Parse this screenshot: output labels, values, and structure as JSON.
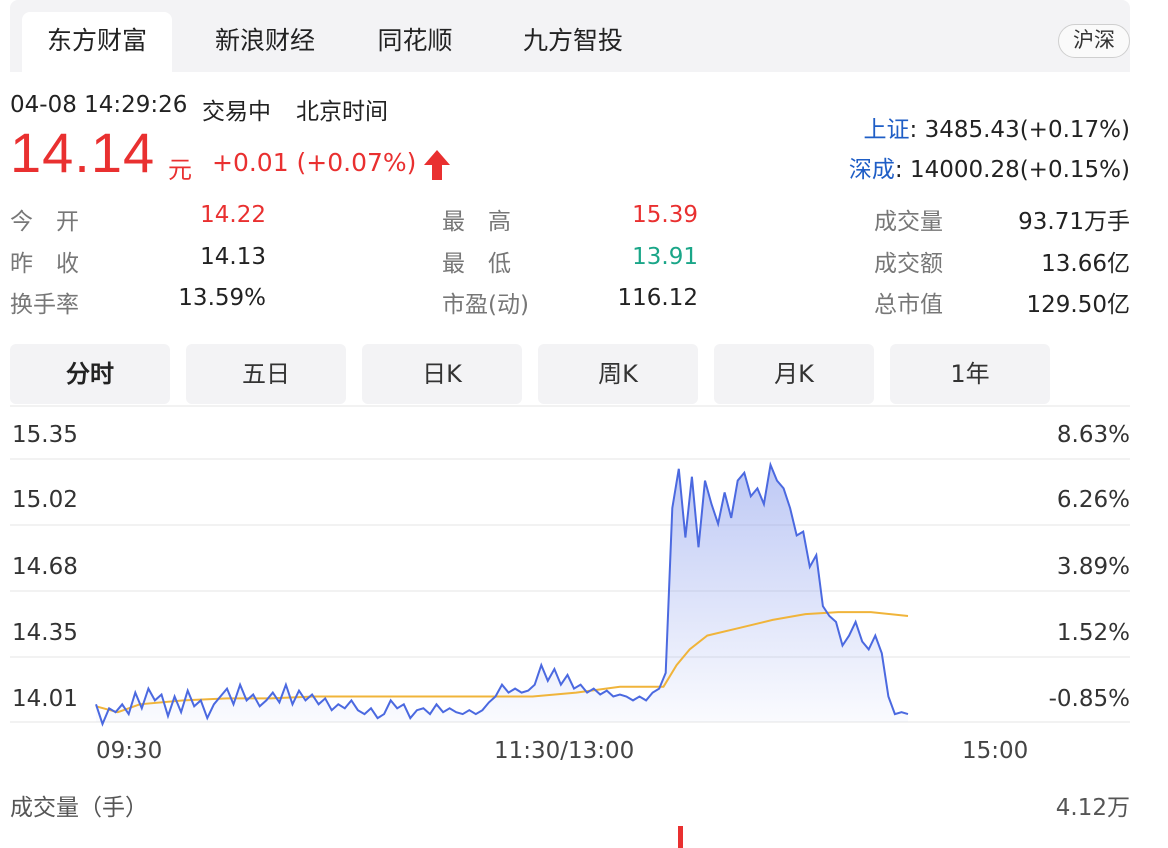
{
  "tabs": [
    "东方财富",
    "新浪财经",
    "同花顺",
    "九方智投"
  ],
  "market_toggle": "沪深",
  "quote": {
    "datetime": "04-08 14:29:26",
    "status": "交易中",
    "timezone": "北京时间",
    "price": "14.14",
    "unit": "元",
    "change": "+0.01 (+0.07%)",
    "direction": "up"
  },
  "indices": [
    {
      "name": "上证",
      "value": ": 3485.43(+0.17%)"
    },
    {
      "name": "深成",
      "value": ": 14000.28(+0.15%)"
    }
  ],
  "stats": {
    "open_label": "今　开",
    "open_value": "14.22",
    "high_label": "最　高",
    "high_value": "15.39",
    "volume_label": "成交量",
    "volume_value": "93.71万手",
    "prev_close_label": "昨　收",
    "prev_close_value": "14.13",
    "low_label": "最　低",
    "low_value": "13.91",
    "amount_label": "成交额",
    "amount_value": "13.66亿",
    "turnover_label": "换手率",
    "turnover_value": "13.59%",
    "pe_label": "市盈(动)",
    "pe_value": "116.12",
    "market_cap_label": "总市值",
    "market_cap_value": "129.50亿"
  },
  "period_tabs": [
    "分时",
    "五日",
    "日K",
    "周K",
    "月K",
    "1年"
  ],
  "chart": {
    "y_left": [
      "15.35",
      "15.02",
      "14.68",
      "14.35",
      "14.01"
    ],
    "y_right": [
      "8.63%",
      "6.26%",
      "3.89%",
      "1.52%",
      "-0.85%"
    ],
    "x_labels": [
      "09:30",
      "11:30/13:00",
      "15:00"
    ],
    "volume_title": "成交量（手）",
    "volume_max": "4.12万"
  },
  "chart_data": {
    "type": "line",
    "ylim": [
      14.01,
      15.35
    ],
    "x_range": [
      0,
      240
    ],
    "series": [
      {
        "values": [
          [
            0,
            14.1
          ],
          [
            3,
            14.0
          ],
          [
            6,
            14.08
          ],
          [
            9,
            14.06
          ],
          [
            12,
            14.1
          ],
          [
            15,
            14.05
          ],
          [
            18,
            14.16
          ],
          [
            21,
            14.08
          ],
          [
            24,
            14.18
          ],
          [
            27,
            14.12
          ],
          [
            30,
            14.15
          ],
          [
            33,
            14.04
          ],
          [
            36,
            14.14
          ],
          [
            39,
            14.06
          ],
          [
            42,
            14.17
          ],
          [
            45,
            14.09
          ],
          [
            48,
            14.12
          ],
          [
            51,
            14.03
          ],
          [
            54,
            14.1
          ],
          [
            57,
            14.14
          ],
          [
            60,
            14.18
          ],
          [
            63,
            14.1
          ],
          [
            66,
            14.2
          ],
          [
            69,
            14.12
          ],
          [
            72,
            14.15
          ],
          [
            75,
            14.09
          ],
          [
            78,
            14.12
          ],
          [
            81,
            14.16
          ],
          [
            84,
            14.11
          ],
          [
            87,
            14.2
          ],
          [
            90,
            14.1
          ],
          [
            93,
            14.17
          ],
          [
            96,
            14.12
          ],
          [
            99,
            14.15
          ],
          [
            102,
            14.1
          ],
          [
            105,
            14.13
          ],
          [
            108,
            14.07
          ],
          [
            111,
            14.1
          ],
          [
            114,
            14.08
          ],
          [
            117,
            14.12
          ],
          [
            120,
            14.07
          ],
          [
            123,
            14.05
          ],
          [
            126,
            14.08
          ],
          [
            129,
            14.03
          ],
          [
            132,
            14.05
          ],
          [
            135,
            14.12
          ],
          [
            138,
            14.08
          ],
          [
            141,
            14.1
          ],
          [
            144,
            14.03
          ],
          [
            147,
            14.07
          ],
          [
            150,
            14.08
          ],
          [
            153,
            14.05
          ],
          [
            156,
            14.1
          ],
          [
            159,
            14.06
          ],
          [
            162,
            14.08
          ],
          [
            165,
            14.06
          ],
          [
            168,
            14.05
          ],
          [
            171,
            14.07
          ],
          [
            174,
            14.05
          ],
          [
            177,
            14.07
          ],
          [
            180,
            14.11
          ],
          [
            183,
            14.14
          ],
          [
            186,
            14.2
          ],
          [
            189,
            14.16
          ],
          [
            192,
            14.18
          ],
          [
            195,
            14.16
          ],
          [
            198,
            14.17
          ],
          [
            201,
            14.2
          ],
          [
            204,
            14.3
          ],
          [
            207,
            14.22
          ],
          [
            210,
            14.28
          ],
          [
            213,
            14.2
          ],
          [
            216,
            14.25
          ],
          [
            219,
            14.18
          ],
          [
            222,
            14.2
          ],
          [
            225,
            14.16
          ],
          [
            228,
            14.18
          ],
          [
            231,
            14.15
          ],
          [
            234,
            14.17
          ],
          [
            237,
            14.14
          ],
          [
            240,
            14.15
          ],
          [
            243,
            14.14
          ],
          [
            246,
            14.12
          ],
          [
            249,
            14.14
          ],
          [
            252,
            14.12
          ],
          [
            255,
            14.16
          ],
          [
            258,
            14.18
          ],
          [
            261,
            14.26
          ],
          [
            264,
            15.1
          ],
          [
            267,
            15.3
          ],
          [
            270,
            14.95
          ],
          [
            273,
            15.26
          ],
          [
            276,
            14.9
          ],
          [
            279,
            15.24
          ],
          [
            282,
            15.12
          ],
          [
            285,
            15.02
          ],
          [
            288,
            15.18
          ],
          [
            291,
            15.05
          ],
          [
            294,
            15.24
          ],
          [
            297,
            15.28
          ],
          [
            300,
            15.16
          ],
          [
            303,
            15.2
          ],
          [
            306,
            15.12
          ],
          [
            309,
            15.32
          ],
          [
            312,
            15.24
          ],
          [
            315,
            15.2
          ],
          [
            318,
            15.1
          ],
          [
            321,
            14.96
          ],
          [
            324,
            14.98
          ],
          [
            327,
            14.8
          ],
          [
            330,
            14.86
          ],
          [
            333,
            14.6
          ],
          [
            336,
            14.55
          ],
          [
            339,
            14.52
          ],
          [
            342,
            14.4
          ],
          [
            345,
            14.45
          ],
          [
            348,
            14.52
          ],
          [
            351,
            14.42
          ],
          [
            354,
            14.38
          ],
          [
            357,
            14.45
          ],
          [
            360,
            14.36
          ],
          [
            363,
            14.14
          ],
          [
            366,
            14.05
          ],
          [
            369,
            14.06
          ],
          [
            372,
            14.05
          ]
        ]
      },
      {
        "values": [
          [
            0,
            14.09
          ],
          [
            10,
            14.06
          ],
          [
            20,
            14.1
          ],
          [
            40,
            14.12
          ],
          [
            60,
            14.13
          ],
          [
            80,
            14.13
          ],
          [
            100,
            14.14
          ],
          [
            120,
            14.14
          ],
          [
            140,
            14.14
          ],
          [
            160,
            14.14
          ],
          [
            180,
            14.14
          ],
          [
            200,
            14.14
          ],
          [
            220,
            14.16
          ],
          [
            240,
            14.19
          ],
          [
            260,
            14.19
          ],
          [
            266,
            14.3
          ],
          [
            272,
            14.38
          ],
          [
            280,
            14.45
          ],
          [
            295,
            14.49
          ],
          [
            310,
            14.53
          ],
          [
            325,
            14.56
          ],
          [
            340,
            14.57
          ],
          [
            355,
            14.57
          ],
          [
            372,
            14.55
          ]
        ]
      }
    ]
  }
}
